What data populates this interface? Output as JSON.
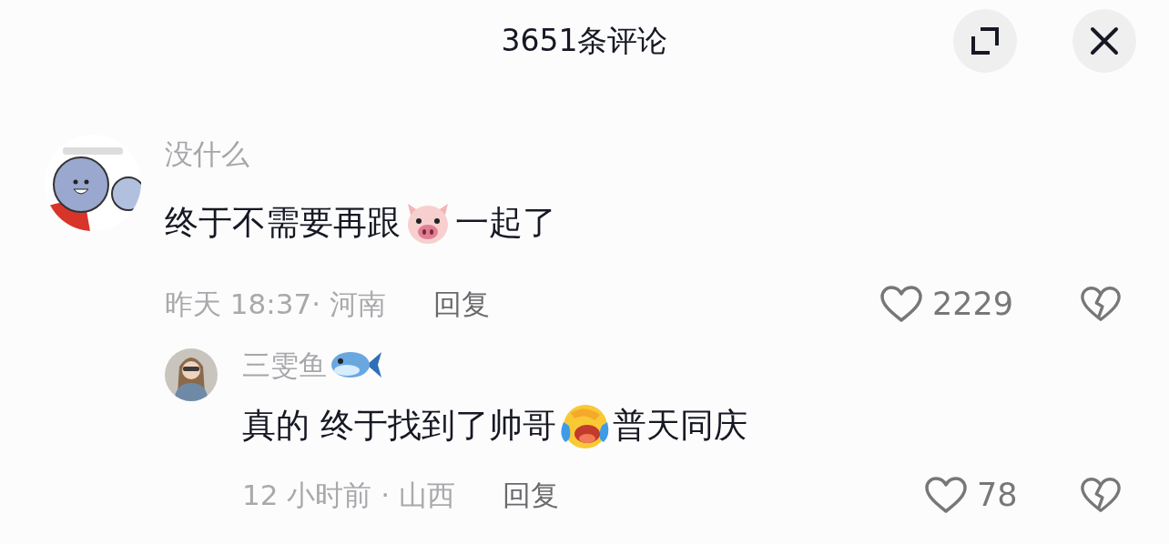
{
  "header": {
    "title": "3651条评论",
    "buttons": [
      {
        "kind": "expand"
      },
      {
        "kind": "close"
      }
    ]
  },
  "comments": [
    {
      "username": "没什么",
      "avatar": {
        "kind": "picture"
      },
      "content": [
        {
          "kind": "text",
          "text": "终于不需要再跟"
        },
        {
          "kind": "pig-emoji"
        },
        {
          "kind": "text",
          "text": "一起了"
        }
      ],
      "meta": "昨天 18:37· 河南",
      "reply_label": "回复",
      "likes": "2229",
      "replies": [
        {
          "username": "三雯鱼",
          "badge": {
            "kind": "fish-emoji"
          },
          "avatar": {
            "kind": "person"
          },
          "content": [
            {
              "kind": "text",
              "text": "真的 终于找到了帅哥"
            },
            {
              "kind": "laughing-crying-emoji"
            },
            {
              "kind": "text",
              "text": "普天同庆"
            }
          ],
          "meta": "12 小时前 · 山西",
          "reply_label": "回复",
          "likes": "78"
        }
      ]
    }
  ]
}
